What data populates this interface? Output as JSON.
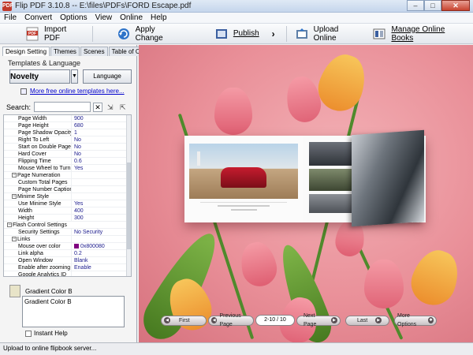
{
  "window": {
    "title": "Flip PDF 3.10.8  -- E:\\files\\PDFs\\FORD Escape.pdf",
    "app_icon_text": "PDF"
  },
  "menu": [
    "File",
    "Convert",
    "Options",
    "View",
    "Online",
    "Help"
  ],
  "toolbar": {
    "import_pdf": "Import PDF",
    "apply_change": "Apply Change",
    "publish": "Publish",
    "upload_online": "Upload Online",
    "manage_online_books": "Manage Online Books"
  },
  "left_panel": {
    "tabs": [
      "Design Setting",
      "Themes",
      "Scenes",
      "Table of Contents"
    ],
    "templates_label": "Templates & Language",
    "template_name": "Novelty",
    "language_button": "Language",
    "more_templates_link": "More free online templates here...",
    "search_label": "Search:",
    "search_value": ""
  },
  "properties": [
    {
      "type": "prop",
      "name": "Page Width",
      "value": "900"
    },
    {
      "type": "prop",
      "name": "Page Height",
      "value": "680"
    },
    {
      "type": "prop",
      "name": "Page Shadow Opacity",
      "value": "1"
    },
    {
      "type": "prop",
      "name": "Right To Left",
      "value": "No"
    },
    {
      "type": "prop",
      "name": "Start on Double Page",
      "value": "No"
    },
    {
      "type": "prop",
      "name": "Hard Cover",
      "value": "No"
    },
    {
      "type": "prop",
      "name": "Flipping Time",
      "value": "0.6"
    },
    {
      "type": "prop",
      "name": "Mouse Wheel to Turn P...",
      "value": "Yes"
    },
    {
      "type": "subgroup",
      "name": "Page Numeration",
      "value": ""
    },
    {
      "type": "prop",
      "name": "Custom Total Pages",
      "value": ""
    },
    {
      "type": "prop",
      "name": "Page Number Caption",
      "value": ""
    },
    {
      "type": "subgroup",
      "name": "Minime Style",
      "value": ""
    },
    {
      "type": "prop",
      "name": "Use Minime Style",
      "value": "Yes"
    },
    {
      "type": "prop",
      "name": "Width",
      "value": "400"
    },
    {
      "type": "prop",
      "name": "Height",
      "value": "300"
    },
    {
      "type": "group",
      "name": "Flash Control Settings",
      "value": ""
    },
    {
      "type": "prop",
      "name": "Security Settings",
      "value": "No Security"
    },
    {
      "type": "subgroup",
      "name": "Links",
      "value": ""
    },
    {
      "type": "prop",
      "name": "Mouse over color",
      "value": "0x800080",
      "swatch": "#800080"
    },
    {
      "type": "prop",
      "name": "Link alpha",
      "value": "0.2"
    },
    {
      "type": "prop",
      "name": "Open Window",
      "value": "Blank"
    },
    {
      "type": "prop",
      "name": "Enable after zooming in",
      "value": "Enable"
    },
    {
      "type": "prop",
      "name": "Google Analytics ID",
      "value": ""
    }
  ],
  "help": {
    "title": "Gradient Color B",
    "body": "Gradient Color B",
    "instant_help_label": "Instant Help",
    "instant_help_checked": false
  },
  "status": "Upload to online flipbook server...",
  "preview": {
    "nav": {
      "first": "First",
      "previous": "Previous Page",
      "page_indicator": "2-10 / 10",
      "next": "Next Page",
      "last": "Last",
      "more_options": "More Options"
    }
  },
  "colors": {
    "background_pink": "#e98f98",
    "tulip_orange": "#f2a23a",
    "tulip_pink": "#ef7f8c",
    "car_red": "#c61c2f"
  }
}
